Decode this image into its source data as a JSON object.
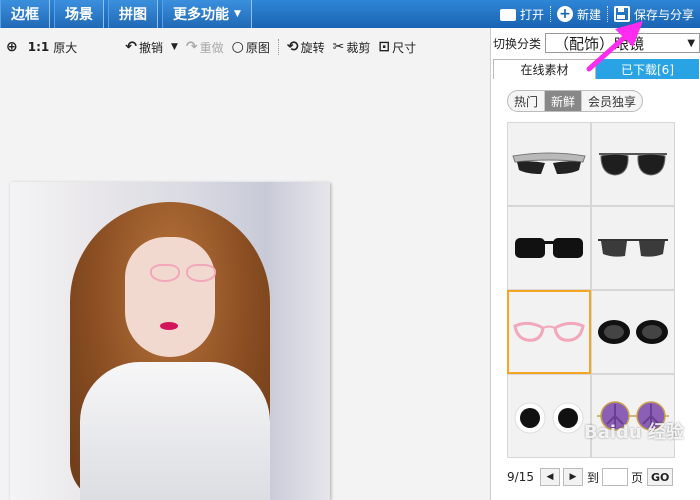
{
  "topbar": {
    "tabs": [
      {
        "label": "边框"
      },
      {
        "label": "场景"
      },
      {
        "label": "拼图"
      },
      {
        "label": "更多功能"
      }
    ],
    "actions": {
      "open": "打开",
      "new": "新建",
      "save": "保存与分享"
    }
  },
  "toolbar": {
    "zoom_label": "1:1",
    "original_size": "原大",
    "undo": "撤销",
    "redo": "重做",
    "original": "原图",
    "rotate": "旋转",
    "crop": "裁剪",
    "size": "尺寸"
  },
  "panel": {
    "category_label": "切换分类",
    "category_value": "（配饰）眼镜",
    "tab_online": "在线素材",
    "tab_downloaded": "已下载[6]",
    "filters": [
      "热门",
      "新鲜",
      "会员独享"
    ],
    "active_filter": "新鲜",
    "pager": {
      "current": "9/15",
      "to": "到",
      "page": "页",
      "go": "GO"
    }
  },
  "watermark": "Baidu 经验",
  "colors": {
    "accent": "#1a63b3",
    "tab_blue": "#2aa3e4",
    "selected": "#f5a623",
    "highlight_arrow": "#ff2cf0"
  }
}
